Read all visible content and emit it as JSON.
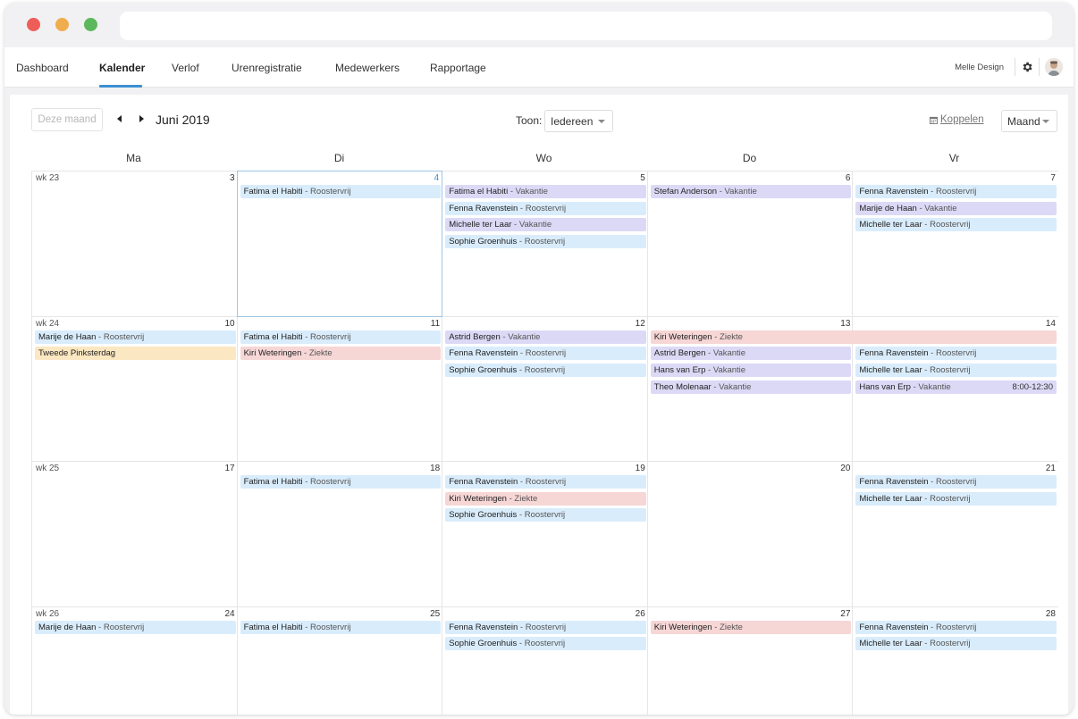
{
  "nav": {
    "items": [
      "Dashboard",
      "Kalender",
      "Verlof",
      "Urenregistratie",
      "Medewerkers",
      "Rapportage"
    ],
    "active": "Kalender",
    "user_name": "Melle Design"
  },
  "toolbar": {
    "today_label": "Deze maand",
    "month_title": "Juni 2019",
    "toon_label": "Toon:",
    "toon_value": "Iedereen",
    "koppelen_label": "Koppelen",
    "view_value": "Maand"
  },
  "calendar": {
    "day_headers": [
      "Ma",
      "Di",
      "Wo",
      "Do",
      "Vr"
    ],
    "weeks": [
      {
        "label": "wk 23",
        "days": [
          "3",
          "4",
          "5",
          "6",
          "7"
        ]
      },
      {
        "label": "wk 24",
        "days": [
          "10",
          "11",
          "12",
          "13",
          "14"
        ]
      },
      {
        "label": "wk 25",
        "days": [
          "17",
          "18",
          "19",
          "20",
          "21"
        ]
      },
      {
        "label": "wk 26",
        "days": [
          "24",
          "25",
          "26",
          "27",
          "28"
        ]
      }
    ],
    "today": "4",
    "events": [
      {
        "week": 0,
        "day": 1,
        "slot": 0,
        "span": 1,
        "name": "Fatima el Habiti",
        "type": "Roostervrij",
        "color": "blue"
      },
      {
        "week": 0,
        "day": 2,
        "slot": 0,
        "span": 1,
        "name": "Fatima el Habiti",
        "type": "Vakantie",
        "color": "purple"
      },
      {
        "week": 0,
        "day": 2,
        "slot": 1,
        "span": 1,
        "name": "Fenna Ravenstein",
        "type": "Roostervrij",
        "color": "blue"
      },
      {
        "week": 0,
        "day": 2,
        "slot": 2,
        "span": 1,
        "name": "Michelle ter Laar",
        "type": "Vakantie",
        "color": "purple"
      },
      {
        "week": 0,
        "day": 2,
        "slot": 3,
        "span": 1,
        "name": "Sophie Groenhuis",
        "type": "Roostervrij",
        "color": "blue"
      },
      {
        "week": 0,
        "day": 3,
        "slot": 0,
        "span": 1,
        "name": "Stefan Anderson",
        "type": "Vakantie",
        "color": "purple"
      },
      {
        "week": 0,
        "day": 4,
        "slot": 0,
        "span": 1,
        "name": "Fenna Ravenstein",
        "type": "Roostervrij",
        "color": "blue"
      },
      {
        "week": 0,
        "day": 4,
        "slot": 1,
        "span": 1,
        "name": "Marije de Haan",
        "type": "Vakantie",
        "color": "purple"
      },
      {
        "week": 0,
        "day": 4,
        "slot": 2,
        "span": 1,
        "name": "Michelle ter Laar",
        "type": "Roostervrij",
        "color": "blue"
      },
      {
        "week": 1,
        "day": 0,
        "slot": 0,
        "span": 1,
        "name": "Marije de Haan",
        "type": "Roostervrij",
        "color": "blue"
      },
      {
        "week": 1,
        "day": 0,
        "slot": 1,
        "span": 1,
        "name": "Tweede Pinksterdag",
        "type": "",
        "color": "yellow"
      },
      {
        "week": 1,
        "day": 1,
        "slot": 0,
        "span": 1,
        "name": "Fatima el Habiti",
        "type": "Roostervrij",
        "color": "blue"
      },
      {
        "week": 1,
        "day": 1,
        "slot": 1,
        "span": 1,
        "name": "Kiri Weteringen",
        "type": "Ziekte",
        "color": "red"
      },
      {
        "week": 1,
        "day": 2,
        "slot": 0,
        "span": 1,
        "name": "Astrid Bergen",
        "type": "Vakantie",
        "color": "purple"
      },
      {
        "week": 1,
        "day": 2,
        "slot": 1,
        "span": 1,
        "name": "Fenna Ravenstein",
        "type": "Roostervrij",
        "color": "blue"
      },
      {
        "week": 1,
        "day": 2,
        "slot": 2,
        "span": 1,
        "name": "Sophie Groenhuis",
        "type": "Roostervrij",
        "color": "blue"
      },
      {
        "week": 1,
        "day": 3,
        "slot": 0,
        "span": 2,
        "name": "Kiri Weteringen",
        "type": "Ziekte",
        "color": "red"
      },
      {
        "week": 1,
        "day": 3,
        "slot": 1,
        "span": 1,
        "name": "Astrid Bergen",
        "type": "Vakantie",
        "color": "purple"
      },
      {
        "week": 1,
        "day": 3,
        "slot": 2,
        "span": 1,
        "name": "Hans van Erp",
        "type": "Vakantie",
        "color": "purple"
      },
      {
        "week": 1,
        "day": 3,
        "slot": 3,
        "span": 1,
        "name": "Theo Molenaar",
        "type": "Vakantie",
        "color": "purple"
      },
      {
        "week": 1,
        "day": 4,
        "slot": 1,
        "span": 1,
        "name": "Fenna Ravenstein",
        "type": "Roostervrij",
        "color": "blue"
      },
      {
        "week": 1,
        "day": 4,
        "slot": 2,
        "span": 1,
        "name": "Michelle ter Laar",
        "type": "Roostervrij",
        "color": "blue"
      },
      {
        "week": 1,
        "day": 4,
        "slot": 3,
        "span": 1,
        "name": "Hans van Erp",
        "type": "Vakantie",
        "color": "purple",
        "time": "8:00-12:30"
      },
      {
        "week": 2,
        "day": 1,
        "slot": 0,
        "span": 1,
        "name": "Fatima el Habiti",
        "type": "Roostervrij",
        "color": "blue"
      },
      {
        "week": 2,
        "day": 2,
        "slot": 0,
        "span": 1,
        "name": "Fenna Ravenstein",
        "type": "Roostervrij",
        "color": "blue"
      },
      {
        "week": 2,
        "day": 2,
        "slot": 1,
        "span": 1,
        "name": "Kiri Weteringen",
        "type": "Ziekte",
        "color": "red"
      },
      {
        "week": 2,
        "day": 2,
        "slot": 2,
        "span": 1,
        "name": "Sophie Groenhuis",
        "type": "Roostervrij",
        "color": "blue"
      },
      {
        "week": 2,
        "day": 4,
        "slot": 0,
        "span": 1,
        "name": "Fenna Ravenstein",
        "type": "Roostervrij",
        "color": "blue"
      },
      {
        "week": 2,
        "day": 4,
        "slot": 1,
        "span": 1,
        "name": "Michelle ter Laar",
        "type": "Roostervrij",
        "color": "blue"
      },
      {
        "week": 3,
        "day": 0,
        "slot": 0,
        "span": 1,
        "name": "Marije de Haan",
        "type": "Roostervrij",
        "color": "blue"
      },
      {
        "week": 3,
        "day": 1,
        "slot": 0,
        "span": 1,
        "name": "Fatima el Habiti",
        "type": "Roostervrij",
        "color": "blue"
      },
      {
        "week": 3,
        "day": 2,
        "slot": 0,
        "span": 1,
        "name": "Fenna Ravenstein",
        "type": "Roostervrij",
        "color": "blue"
      },
      {
        "week": 3,
        "day": 2,
        "slot": 1,
        "span": 1,
        "name": "Sophie Groenhuis",
        "type": "Roostervrij",
        "color": "blue"
      },
      {
        "week": 3,
        "day": 3,
        "slot": 0,
        "span": 1,
        "name": "Kiri Weteringen",
        "type": "Ziekte",
        "color": "red"
      },
      {
        "week": 3,
        "day": 4,
        "slot": 0,
        "span": 1,
        "name": "Fenna Ravenstein",
        "type": "Roostervrij",
        "color": "blue"
      },
      {
        "week": 3,
        "day": 4,
        "slot": 1,
        "span": 1,
        "name": "Michelle ter Laar",
        "type": "Roostervrij",
        "color": "blue"
      }
    ]
  },
  "colors": {
    "accent": "#3c8fd1",
    "roostervrij": "#d9ecfb",
    "vakantie": "#dcd9f6",
    "ziekte": "#f7d6d6",
    "feestdag": "#fbe7c1"
  },
  "icons": {
    "settings": "gear-icon",
    "koppelen": "calendar-icon",
    "prev": "caret-left-icon",
    "next": "caret-right-icon"
  }
}
